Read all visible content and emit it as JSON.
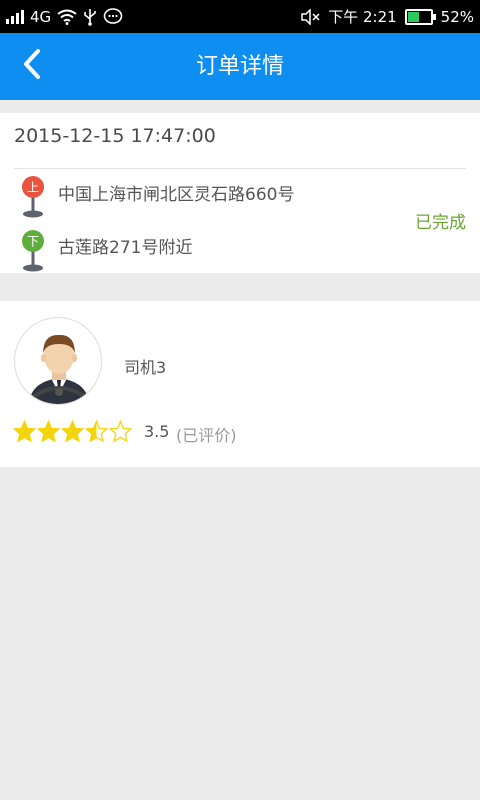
{
  "status_bar": {
    "network": "4G",
    "time": "下午 2:21",
    "battery_percent": "52%",
    "battery_level": 0.52,
    "icons": [
      "signal-icon",
      "wifi-icon",
      "usb-icon",
      "message-icon",
      "mute-icon",
      "battery-icon"
    ]
  },
  "header": {
    "title": "订单详情",
    "back_icon": "chevron-left-icon",
    "color": "#0f8ef2"
  },
  "order": {
    "datetime": "2015-12-15 17:47:00",
    "pickup_badge": "上",
    "pickup_address": "中国上海市闸北区灵石路660号",
    "dropoff_badge": "下",
    "dropoff_address": "古莲路271号附近",
    "status": "已完成",
    "colors": {
      "pickup": "#e8543f",
      "dropoff": "#5fae3b",
      "status": "#6aa534"
    }
  },
  "driver": {
    "name": "司机3",
    "rating": 3.5,
    "rating_text": "3.5",
    "rating_status": "(已评价)",
    "max_stars": 5,
    "star_color": "#f5d50a"
  }
}
